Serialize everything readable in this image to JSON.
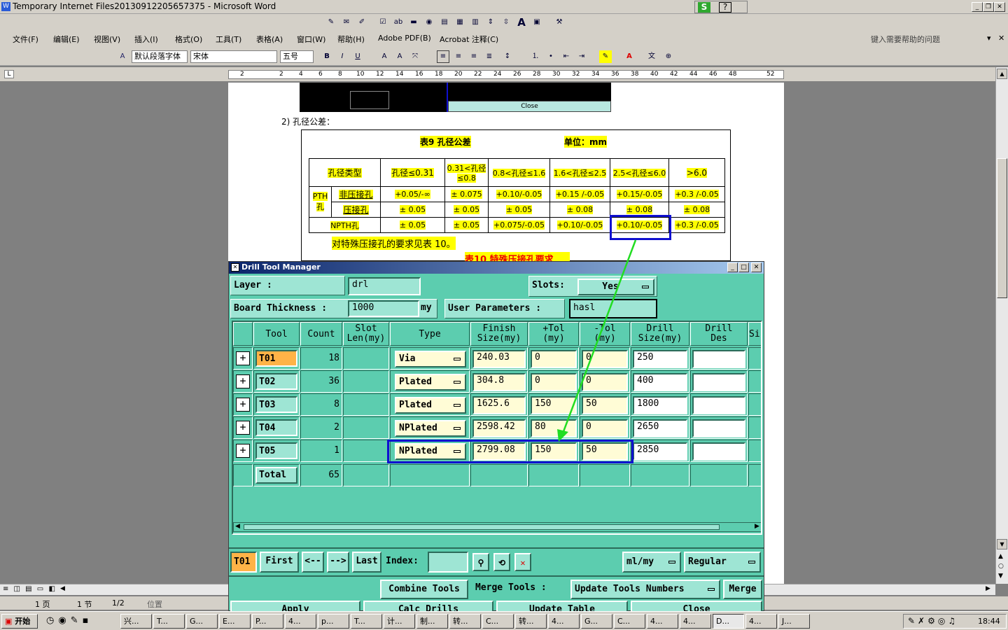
{
  "window": {
    "title": "Temporary Internet Files20130912205657375 - Microsoft Word"
  },
  "menu": [
    "文件(F)",
    "编辑(E)",
    "视图(V)",
    "插入(I)",
    "格式(O)",
    "工具(T)",
    "表格(A)",
    "窗口(W)",
    "帮助(H)",
    "Adobe PDF(B)",
    "Acrobat 注释(C)"
  ],
  "help_placeholder": "键入需要帮助的问题",
  "format": {
    "style": "默认段落字体",
    "font": "宋体",
    "size": "五号"
  },
  "ruler": [
    "2",
    "2",
    "4",
    "6",
    "8",
    "10",
    "12",
    "14",
    "16",
    "18",
    "20",
    "22",
    "24",
    "26",
    "28",
    "30",
    "32",
    "34",
    "36",
    "38",
    "40",
    "42",
    "44",
    "46",
    "48",
    "52"
  ],
  "doc": {
    "close_label": "Close",
    "section": "2)  孔径公差：",
    "table_title": "表9   孔径公差",
    "unit": "单位：mm",
    "headers": [
      "孔径类型",
      "孔径≤0.31",
      "0.31<孔径≤0.8",
      "0.8<孔径≤1.6",
      "1.6<孔径≤2.5",
      "2.5<孔径≤6.0",
      ">6.0"
    ],
    "pth": "PTH孔",
    "rows": [
      {
        "label": "非压接孔",
        "values": [
          "+0.05/-∞",
          "± 0.075",
          "+0.10/-0.05",
          "+0.15 /-0.05",
          "+0.15/-0.05",
          "+0.3 /-0.05"
        ]
      },
      {
        "label": "压接孔",
        "values": [
          "± 0.05",
          "± 0.05",
          "± 0.05",
          "± 0.08",
          "± 0.08",
          "± 0.08"
        ]
      },
      {
        "label": "NPTH孔",
        "values": [
          "± 0.05",
          "± 0.05",
          "+0.075/-0.05",
          "+0.10/-0.05",
          "+0.10/-0.05",
          "+0.3 /-0.05"
        ]
      }
    ],
    "note": "对特殊压接孔的要求见表 10。",
    "next_title": "表10   特殊压接孔要求"
  },
  "dialog": {
    "title": "Drill Tool Manager",
    "layer_label": "Layer          :",
    "layer_value": "drl",
    "slots_label": "Slots:",
    "slots_value": "Yes",
    "thickness_label": "Board Thickness :",
    "thickness_value": "1000",
    "thickness_unit": "my",
    "userparams_label": "User Parameters :",
    "userparams_value": "hasl",
    "columns": [
      "Tool",
      "Count",
      "Slot Len(my)",
      "Type",
      "Finish Size(my)",
      "+Tol (my)",
      "-Tol (my)",
      "Drill Size(my)",
      "Drill Des",
      "Si"
    ],
    "tools": [
      {
        "tool": "T01",
        "count": "18",
        "type": "Via",
        "finish": "240.03",
        "ptol": "0",
        "ntol": "0",
        "drill": "250"
      },
      {
        "tool": "T02",
        "count": "36",
        "type": "Plated",
        "finish": "304.8",
        "ptol": "0",
        "ntol": "0",
        "drill": "400"
      },
      {
        "tool": "T03",
        "count": "8",
        "type": "Plated",
        "finish": "1625.6",
        "ptol": "150",
        "ntol": "50",
        "drill": "1800"
      },
      {
        "tool": "T04",
        "count": "2",
        "type": "NPlated",
        "finish": "2598.42",
        "ptol": "80",
        "ntol": "0",
        "drill": "2650"
      },
      {
        "tool": "T05",
        "count": "1",
        "type": "NPlated",
        "finish": "2799.08",
        "ptol": "150",
        "ntol": "50",
        "drill": "2850"
      }
    ],
    "total_label": "Total",
    "total_count": "65",
    "current_tool": "T01",
    "nav": {
      "first": "First",
      "prev": "<--",
      "next": "-->",
      "last": "Last",
      "index": "Index:"
    },
    "units": "ml/my",
    "mode": "Regular",
    "combine": "Combine Tools",
    "merge_label": "Merge Tools :",
    "update_numbers": "Update Tools Numbers",
    "merge": "Merge",
    "apply": "Apply",
    "calc": "Calc Drills",
    "update_table": "Update Table",
    "close": "Close"
  },
  "status": {
    "page": "1 页",
    "section": "1 节",
    "pages": "1/2",
    "pos": "位置"
  },
  "taskbar": {
    "start": "开始",
    "tasks": [
      "兴...",
      "T...",
      "G...",
      "E...",
      "P...",
      "4...",
      "p...",
      "T...",
      "计...",
      "制...",
      "转...",
      "C...",
      "转...",
      "4...",
      "G...",
      "C...",
      "4...",
      "4...",
      "D...",
      "4...",
      "J..."
    ],
    "clock": "18:44"
  },
  "colors": {
    "dialog_bg": "#5ccdaf",
    "highlight": "#1010d0",
    "arrow": "#22dd22",
    "tool_btn": "#ffb347"
  }
}
